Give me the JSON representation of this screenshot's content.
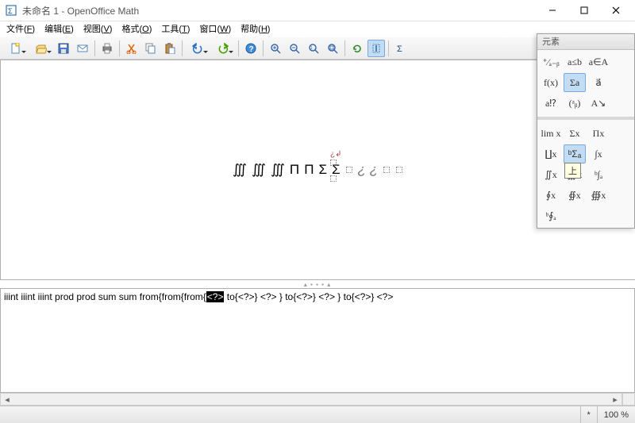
{
  "window": {
    "title": "未命名 1 - OpenOffice Math"
  },
  "menu": {
    "file": {
      "label": "文件",
      "accel": "F"
    },
    "edit": {
      "label": "编辑",
      "accel": "E"
    },
    "view": {
      "label": "视图",
      "accel": "V"
    },
    "format": {
      "label": "格式",
      "accel": "O"
    },
    "tools": {
      "label": "工具",
      "accel": "T"
    },
    "window": {
      "label": "窗口",
      "accel": "W"
    },
    "help": {
      "label": "帮助",
      "accel": "H"
    }
  },
  "toolbar_icons": {
    "new": "new-doc",
    "open": "open",
    "save": "save",
    "mail": "mail",
    "print": "print",
    "cut": "cut",
    "copy": "copy",
    "paste": "paste",
    "undo": "undo",
    "redo": "redo",
    "help": "help",
    "zoom_in": "zoom-in",
    "zoom_out": "zoom-out",
    "zoom_100": "zoom-100",
    "zoom_fit": "zoom-fit",
    "refresh": "refresh",
    "cursor": "formula-cursor",
    "elements": "elements"
  },
  "palette": {
    "title": "元素",
    "top": [
      {
        "id": "unary-binary",
        "glyph": "⁺⁄ₐ₋ᵦ"
      },
      {
        "id": "relations",
        "glyph": "a≤b"
      },
      {
        "id": "set-ops",
        "glyph": "a∈A"
      },
      {
        "id": "functions",
        "glyph": "f(x)"
      },
      {
        "id": "operators",
        "glyph": "Σa",
        "selected": true
      },
      {
        "id": "attributes",
        "glyph": "a⃗"
      },
      {
        "id": "others",
        "glyph": "a⁉"
      },
      {
        "id": "brackets",
        "glyph": "(ᵃᵦ)"
      },
      {
        "id": "formats",
        "glyph": "A↘"
      }
    ],
    "ops": [
      {
        "id": "lim",
        "glyph": "lim x"
      },
      {
        "id": "sum",
        "glyph": "Σx"
      },
      {
        "id": "prod",
        "glyph": "Πx"
      },
      {
        "id": "coprod",
        "glyph": "∐x"
      },
      {
        "id": "sumlimits",
        "glyph": "ᵇΣₐ",
        "selected": true,
        "tooltip": "上"
      },
      {
        "id": "int",
        "glyph": "∫x"
      },
      {
        "id": "iint",
        "glyph": "∬x"
      },
      {
        "id": "iiint",
        "glyph": "∭x"
      },
      {
        "id": "intlimits",
        "glyph": "ᵇ∫ₐ"
      },
      {
        "id": "oint",
        "glyph": "∮x"
      },
      {
        "id": "oiint",
        "glyph": "∯x"
      },
      {
        "id": "oiiint",
        "glyph": "∰x"
      },
      {
        "id": "ointlimits",
        "glyph": "ᵇ∮ₐ"
      }
    ]
  },
  "preview": {
    "symbols": [
      "∭",
      "∭",
      "∭",
      "Π",
      "Π",
      "Σ",
      "Σ"
    ],
    "placeholders": 4,
    "marker": "¿↲"
  },
  "editor": {
    "pre": "iiint iiint iiint prod prod sum sum from{from{from{",
    "sel": "<?>",
    "post": " to{<?>} <?> } to{<?>} <?> } to{<?>} <?>"
  },
  "status": {
    "modified": "*",
    "zoom": "100 %"
  }
}
